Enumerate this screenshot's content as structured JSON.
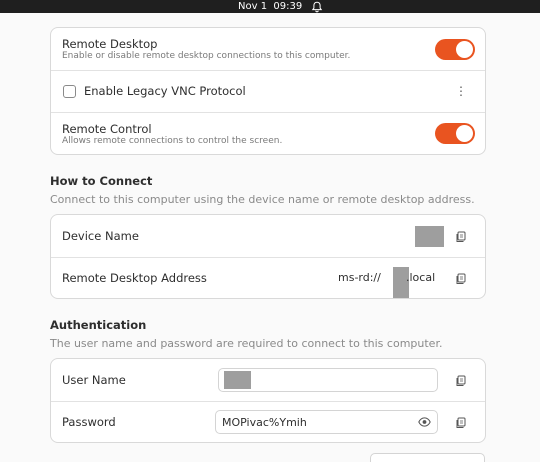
{
  "topbar": {
    "date": "Nov 1",
    "time": "09:39"
  },
  "remote_desktop_card": {
    "remote_desktop": {
      "title": "Remote Desktop",
      "subtitle": "Enable or disable remote desktop connections to this computer.",
      "enabled": true
    },
    "legacy_vnc": {
      "label": "Enable Legacy VNC Protocol",
      "checked": false
    },
    "remote_control": {
      "title": "Remote Control",
      "subtitle": "Allows remote connections to control the screen.",
      "enabled": true
    }
  },
  "how_to_connect": {
    "heading": "How to Connect",
    "description": "Connect to this computer using the device name or remote desktop address.",
    "device_name": {
      "label": "Device Name"
    },
    "address": {
      "label": "Remote Desktop Address",
      "prefix": "ms-rd://",
      "suffix": ".local"
    }
  },
  "authentication": {
    "heading": "Authentication",
    "description": "The user name and password are required to connect to this computer.",
    "user_name": {
      "label": "User Name"
    },
    "password": {
      "label": "Password",
      "value": "MOPivac%Ymih"
    }
  },
  "icons": {
    "notification": "bell-icon",
    "copy": "copy-icon",
    "reveal": "eye-icon",
    "menu": "kebab-menu-icon"
  },
  "colors": {
    "accent": "#e95420",
    "topbar": "#1f1f1f"
  }
}
